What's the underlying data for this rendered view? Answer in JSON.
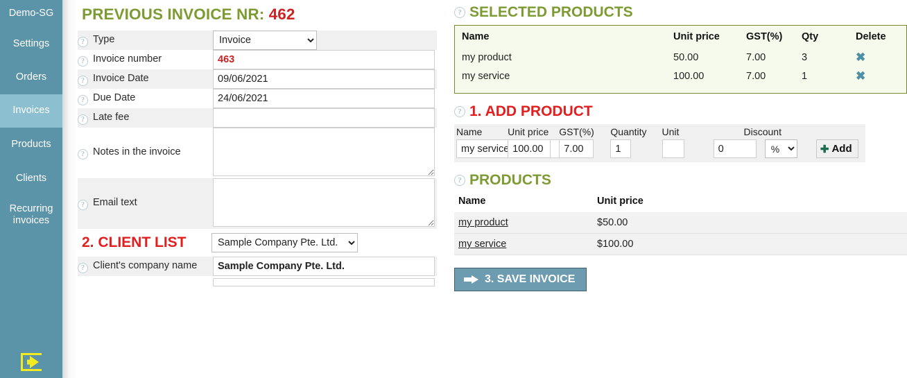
{
  "sidebar": {
    "items": [
      {
        "label": "Demo-SG",
        "active": false
      },
      {
        "label": "Settings",
        "active": false
      },
      {
        "label": "Orders",
        "active": false
      },
      {
        "label": "Invoices",
        "active": true
      },
      {
        "label": "Products",
        "active": false
      },
      {
        "label": "Clients",
        "active": false
      },
      {
        "label": "Recurring invoices",
        "active": false
      }
    ],
    "logout_icon": "logout-icon",
    "bg_color": "#5b93a8",
    "active_color": "#8cc0d1"
  },
  "left": {
    "title_prefix": "PREVIOUS INVOICE NR:",
    "title_number": "462",
    "help_icon": "?",
    "rows": [
      {
        "label": "Type",
        "value": "Invoice",
        "control": "select"
      },
      {
        "label": "Invoice number",
        "value": "463",
        "control": "input-red"
      },
      {
        "label": "Invoice Date",
        "value": "09/06/2021",
        "control": "input"
      },
      {
        "label": "Due Date",
        "value": "24/06/2021",
        "control": "input"
      },
      {
        "label": "Late fee",
        "value": "",
        "control": "input"
      },
      {
        "label": "Notes in the invoice",
        "value": "",
        "control": "textarea"
      },
      {
        "label": "Email text",
        "value": "",
        "control": "textarea"
      }
    ],
    "type_options": [
      "Invoice"
    ],
    "client_list": {
      "title": "2. CLIENT LIST",
      "selected": "Sample Company Pte. Ltd.",
      "options": [
        "Sample Company Pte. Ltd."
      ]
    },
    "client_company": {
      "label": "Client's company name",
      "value": "Sample Company Pte. Ltd."
    }
  },
  "right": {
    "selected_products": {
      "heading": "SELECTED PRODUCTS",
      "columns": [
        "Name",
        "Unit price",
        "GST(%)",
        "Qty",
        "Delete"
      ],
      "rows": [
        {
          "name": "my product",
          "unit_price": "50.00",
          "gst": "7.00",
          "qty": "3",
          "delete_icon": "✖"
        },
        {
          "name": "my service",
          "unit_price": "100.00",
          "gst": "7.00",
          "qty": "1",
          "delete_icon": "✖"
        }
      ],
      "border_color": "#74892c",
      "bg_color": "#f5faec"
    },
    "add_product": {
      "heading": "1. ADD PRODUCT",
      "labels": {
        "name": "Name",
        "unit_price": "Unit price",
        "gst": "GST(%)",
        "quantity": "Quantity",
        "unit": "Unit",
        "discount": "Discount"
      },
      "values": {
        "name": "my service",
        "unit_price": "100.00",
        "gst": "7.00",
        "quantity": "1",
        "unit": "",
        "discount": "0",
        "discount_type": "%"
      },
      "discount_options": [
        "%"
      ],
      "add_button": "Add",
      "add_icon": "✚"
    },
    "products": {
      "heading": "PRODUCTS",
      "columns": [
        "Name",
        "Unit price"
      ],
      "rows": [
        {
          "name": "my product",
          "unit_price": "$50.00"
        },
        {
          "name": "my service",
          "unit_price": "$100.00"
        }
      ]
    },
    "save_button": {
      "label": "3. SAVE INVOICE",
      "icon": "arrow-right-icon",
      "bg_color": "#6d9cb0"
    }
  }
}
